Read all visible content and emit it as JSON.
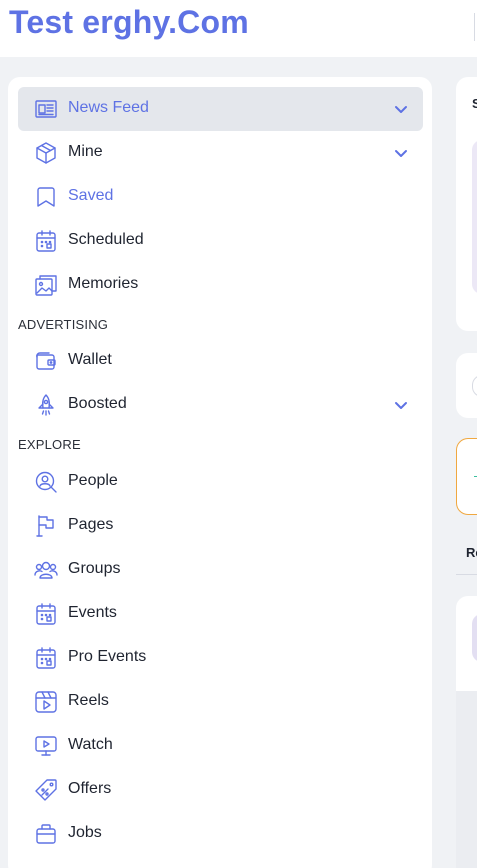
{
  "header": {
    "logo_text": "Test erghy.Com"
  },
  "sidebar": {
    "items": [
      {
        "label": "News Feed",
        "icon": "news-feed-icon",
        "active": true,
        "chevron": true
      },
      {
        "label": "Mine",
        "icon": "box-icon",
        "chevron": true
      },
      {
        "label": "Saved",
        "icon": "bookmark-icon",
        "blue": true
      },
      {
        "label": "Scheduled",
        "icon": "calendar-icon"
      },
      {
        "label": "Memories",
        "icon": "memories-icon"
      }
    ],
    "advertising_label": "ADVERTISING",
    "advertising_items": [
      {
        "label": "Wallet",
        "icon": "wallet-icon"
      },
      {
        "label": "Boosted",
        "icon": "rocket-icon",
        "chevron": true
      }
    ],
    "explore_label": "EXPLORE",
    "explore_items": [
      {
        "label": "People",
        "icon": "people-search-icon"
      },
      {
        "label": "Pages",
        "icon": "flag-icon"
      },
      {
        "label": "Groups",
        "icon": "groups-icon"
      },
      {
        "label": "Events",
        "icon": "calendar-icon"
      },
      {
        "label": "Pro Events",
        "icon": "calendar-icon"
      },
      {
        "label": "Reels",
        "icon": "reels-icon"
      },
      {
        "label": "Watch",
        "icon": "watch-icon"
      },
      {
        "label": "Offers",
        "icon": "offers-tag-icon"
      },
      {
        "label": "Jobs",
        "icon": "briefcase-icon"
      }
    ]
  },
  "right_panel": {
    "partial_text_1": "S",
    "partial_text_2": "Re"
  },
  "colors": {
    "accent": "#5e72e4",
    "active_bg": "#e4e7ec",
    "page_bg": "#f0f2f5"
  }
}
